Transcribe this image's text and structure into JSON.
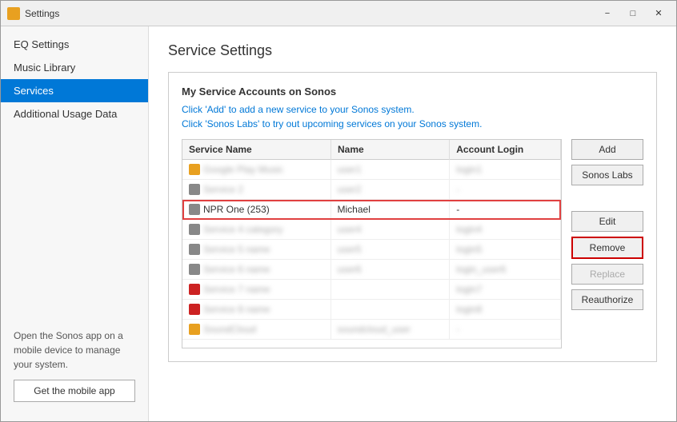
{
  "window": {
    "title": "Settings",
    "icon": "settings-icon"
  },
  "titlebar": {
    "title": "Settings",
    "minimize": "−",
    "maximize": "□",
    "close": "✕"
  },
  "sidebar": {
    "items": [
      {
        "id": "eq-settings",
        "label": "EQ Settings",
        "active": false
      },
      {
        "id": "music-library",
        "label": "Music Library",
        "active": false
      },
      {
        "id": "services",
        "label": "Services",
        "active": true
      },
      {
        "id": "additional-usage",
        "label": "Additional Usage Data",
        "active": false
      }
    ],
    "help_text": "Open the Sonos app on a mobile device to manage your system.",
    "mobile_button": "Get the mobile app"
  },
  "main": {
    "page_title": "Service Settings",
    "panel": {
      "title": "My Service Accounts on Sonos",
      "info1": "Click 'Add' to add a new service to your Sonos system.",
      "info2": "Click 'Sonos Labs' to try out upcoming services on your Sonos system.",
      "table": {
        "columns": [
          "Service Name",
          "Name",
          "Account Login"
        ],
        "rows": [
          {
            "id": 1,
            "icon": "orange",
            "name": "Google Play Music",
            "user": "user1",
            "login": "login1",
            "selected": false,
            "blurred": true
          },
          {
            "id": 2,
            "icon": "gray",
            "name": "Service 2",
            "user": "user2",
            "login": "-",
            "selected": false,
            "blurred": true
          },
          {
            "id": 3,
            "icon": "gray",
            "name": "NPR One (253)",
            "user": "Michael",
            "login": "-",
            "selected": true,
            "blurred": false
          },
          {
            "id": 4,
            "icon": "gray",
            "name": "Service 4",
            "user": "user4",
            "login": "login4",
            "selected": false,
            "blurred": true
          },
          {
            "id": 5,
            "icon": "gray",
            "name": "Service 5",
            "user": "user5",
            "login": "login5",
            "selected": false,
            "blurred": true
          },
          {
            "id": 6,
            "icon": "gray",
            "name": "Service 6",
            "user": "user6",
            "login": "login6",
            "selected": false,
            "blurred": true
          },
          {
            "id": 7,
            "icon": "red",
            "name": "Service 7",
            "user": "",
            "login": "login7",
            "selected": false,
            "blurred": true
          },
          {
            "id": 8,
            "icon": "red",
            "name": "Service 8",
            "user": "",
            "login": "login8",
            "selected": false,
            "blurred": true
          },
          {
            "id": 9,
            "icon": "orange",
            "name": "SoundCloud",
            "user": "soundcloud_user",
            "login": "-",
            "selected": false,
            "blurred": true
          }
        ]
      }
    },
    "buttons": {
      "add": "Add",
      "sonos_labs": "Sonos Labs",
      "edit": "Edit",
      "remove": "Remove",
      "replace": "Replace",
      "reauthorize": "Reauthorize"
    }
  }
}
